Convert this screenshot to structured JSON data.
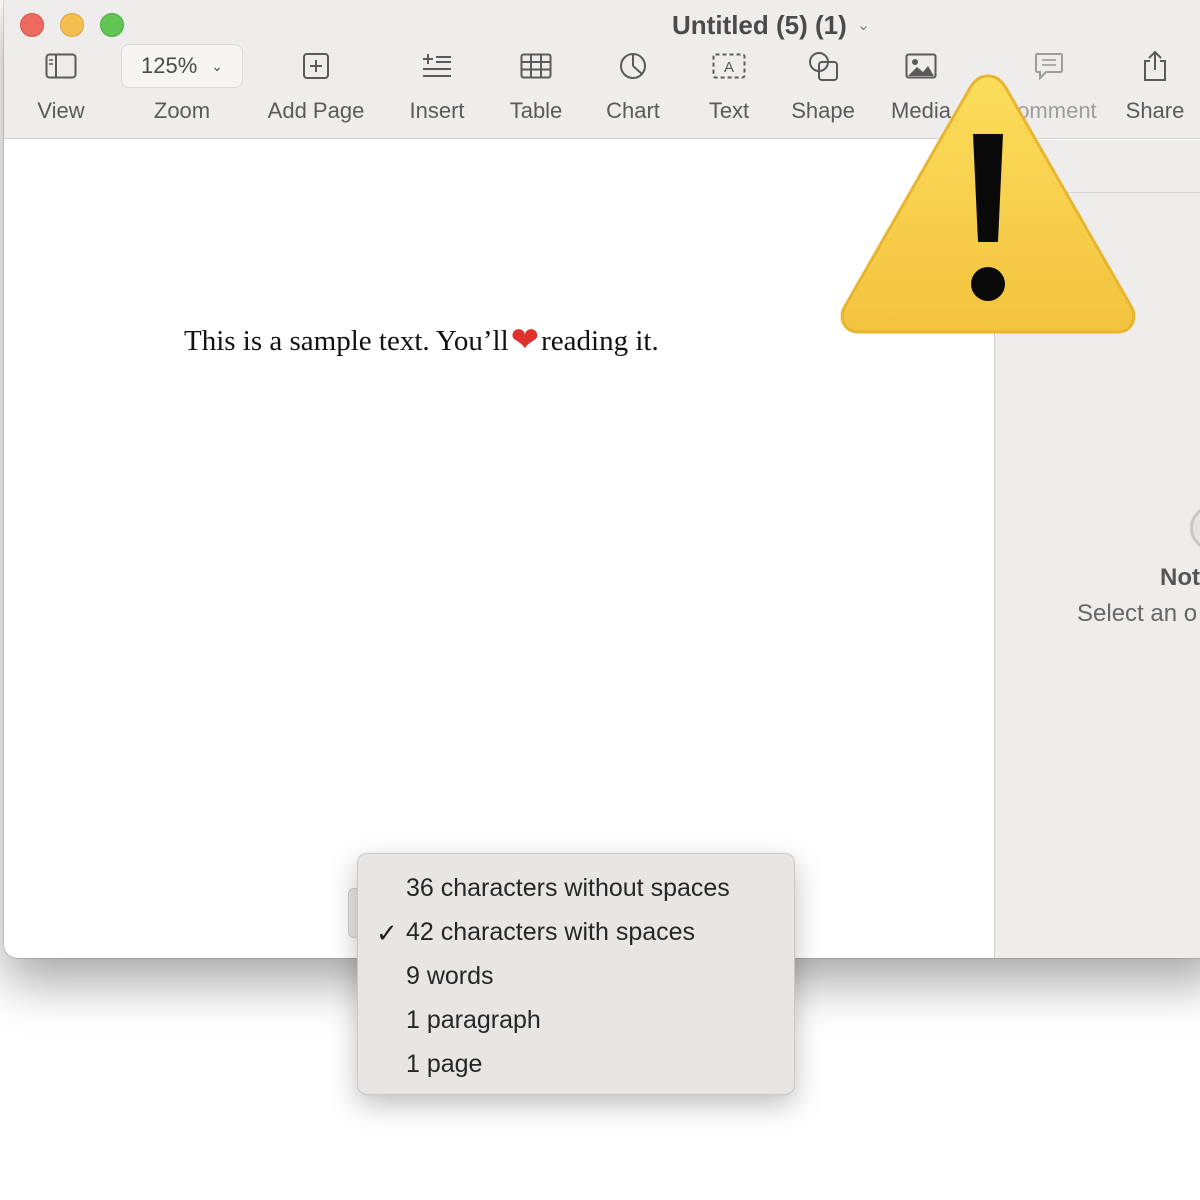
{
  "window": {
    "title": "Untitled (5) (1)"
  },
  "toolbar": {
    "view": {
      "label": "View",
      "icon": "sidebar-icon"
    },
    "zoom": {
      "value": "125%",
      "label": "Zoom"
    },
    "add_page": {
      "label": "Add Page",
      "icon": "add-page-icon"
    },
    "insert": {
      "label": "Insert",
      "icon": "insert-icon"
    },
    "table": {
      "label": "Table",
      "icon": "table-icon"
    },
    "chart": {
      "label": "Chart",
      "icon": "chart-icon"
    },
    "text": {
      "label": "Text",
      "icon": "text-box-icon"
    },
    "shape": {
      "label": "Shape",
      "icon": "shape-icon"
    },
    "media": {
      "label": "Media",
      "icon": "media-icon"
    },
    "comment": {
      "label": "Comment",
      "icon": "comment-icon"
    },
    "share": {
      "label": "Share",
      "icon": "share-icon"
    }
  },
  "document": {
    "text_before": "This is a sample text. You’ll",
    "heart_glyph": "❤",
    "text_after": "reading it."
  },
  "sidebar": {
    "title": "Not",
    "hint": "Select an o"
  },
  "word_count_menu": {
    "items": [
      {
        "label": "36 characters without spaces",
        "checked": false
      },
      {
        "label": "42 characters with spaces",
        "checked": true
      },
      {
        "label": "9 words",
        "checked": false
      },
      {
        "label": "1 paragraph",
        "checked": false
      },
      {
        "label": "1 page",
        "checked": false
      }
    ],
    "check_glyph": "✓"
  },
  "overlay": {
    "icon": "warning-icon",
    "glyph": "!",
    "color": "#f6cb45"
  }
}
